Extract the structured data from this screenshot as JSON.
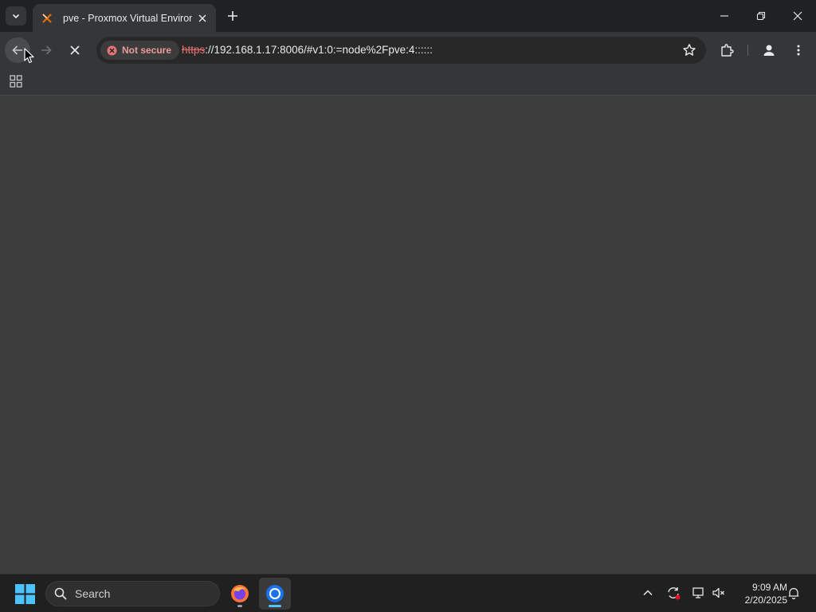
{
  "colors": {
    "tabstrip_bg": "#202124",
    "toolbar_bg": "#35363a",
    "content_bg": "#3c3c3c",
    "taskbar_bg": "#202020",
    "not_secure_red": "#e57373"
  },
  "browser": {
    "tab": {
      "title": "pve - Proxmox Virtual Environm",
      "favicon": "proxmox-icon"
    },
    "omnibox": {
      "security_label": "Not secure",
      "url_scheme": "https",
      "url_rest": "://192.168.1.17:8006/#v1:0:=node%2Fpve:4::::::"
    }
  },
  "taskbar": {
    "search_label": "Search",
    "apps": [
      "firefox-icon",
      "chrome-icon"
    ],
    "clock": {
      "time": "9:09 AM",
      "date": "2/20/2025"
    }
  }
}
